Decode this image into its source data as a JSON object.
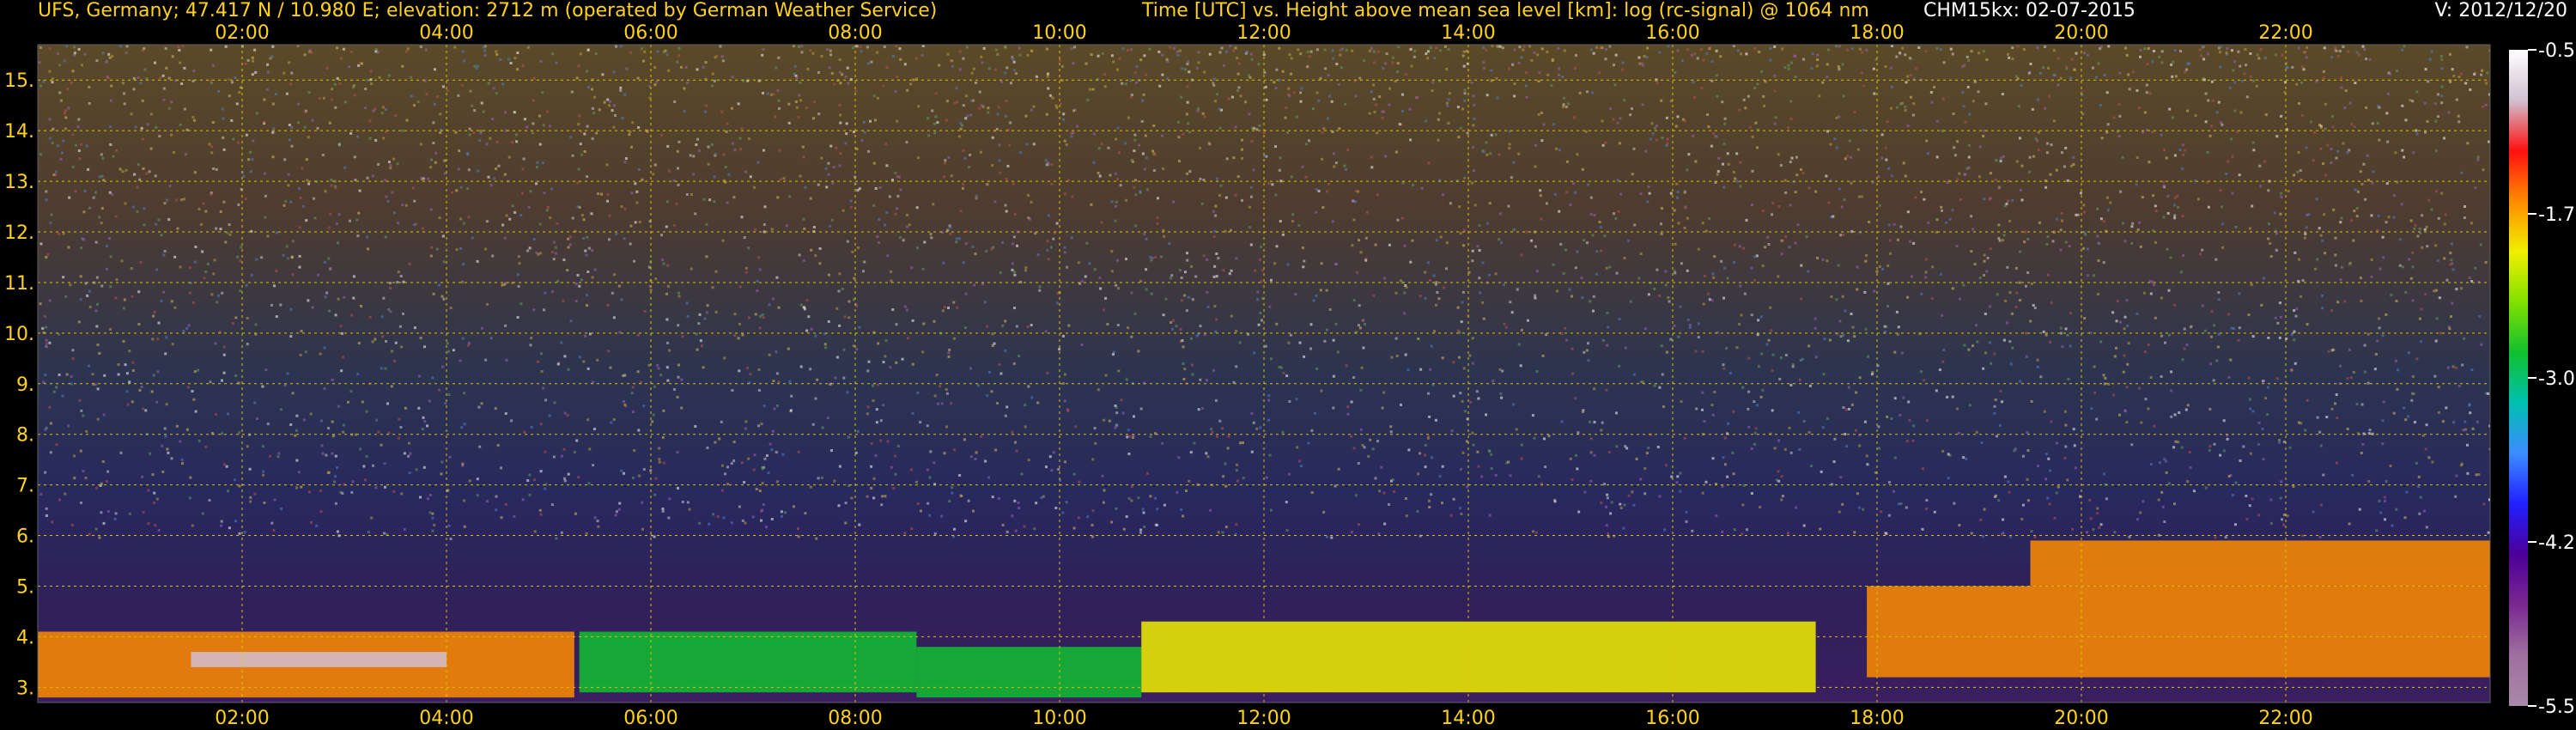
{
  "header": {
    "station": "UFS, Germany; 47.417 N / 10.980 E; elevation: 2712 m  (operated by German Weather Service)",
    "title": "Time [UTC] vs. Height above mean sea level [km]: log (rc-signal) @ 1064 nm",
    "instrument": "CHM15kx: 02-07-2015",
    "version": "V: 2012/12/20"
  },
  "colors": {
    "background": "#000000",
    "header_text": "#ffd21a",
    "tick_text": "#ffd21a",
    "instrument_text": "#ffffff",
    "grid": "#e0c400",
    "colorbar_text": "#ffffff"
  },
  "chart_data": {
    "type": "heatmap",
    "title": "Time [UTC] vs. Height above mean sea level [km]: log (rc-signal) @ 1064 nm",
    "xlabel": "Time [UTC]",
    "ylabel": "Height above mean sea level [km]",
    "x_unit": "hours UTC",
    "xlim": [
      0.0,
      24.0
    ],
    "ylim": [
      2.7,
      15.7
    ],
    "x_ticks": [
      2,
      4,
      6,
      8,
      10,
      12,
      14,
      16,
      18,
      20,
      22
    ],
    "x_tick_labels": [
      "02:00",
      "04:00",
      "06:00",
      "08:00",
      "10:00",
      "12:00",
      "14:00",
      "16:00",
      "18:00",
      "20:00",
      "22:00"
    ],
    "y_ticks": [
      3,
      4,
      5,
      6,
      7,
      8,
      9,
      10,
      11,
      12,
      13,
      14,
      15
    ],
    "y_tick_labels": [
      "3.",
      "4.",
      "5.",
      "6.",
      "7.",
      "8.",
      "9.",
      "10.",
      "11.",
      "12.",
      "13.",
      "14.",
      "15."
    ],
    "grid": true,
    "colorbar": {
      "range": [
        -5.5,
        -0.5
      ],
      "ticks": [
        -5.5,
        -4.25,
        -3.0,
        -1.75,
        -0.5
      ],
      "tick_labels": [
        "-5.50",
        "-4.25",
        "-3.00",
        "-1.75",
        "-0.50"
      ],
      "palette": [
        "#a888a8",
        "#a070a0",
        "#7a2890",
        "#4c0098",
        "#2020ff",
        "#3c8cff",
        "#00c0b0",
        "#10c030",
        "#80e000",
        "#f0f000",
        "#ff8c00",
        "#ff1010",
        "#d0c0d0",
        "#ffffff"
      ]
    },
    "features": [
      {
        "start_h": 0.0,
        "end_h": 5.25,
        "y_bottom_km": 2.8,
        "y_top_km": 4.1,
        "value": -1.6
      },
      {
        "start_h": 1.5,
        "end_h": 4.0,
        "y_bottom_km": 3.4,
        "y_top_km": 3.7,
        "value": -1.0
      },
      {
        "start_h": 5.3,
        "end_h": 8.6,
        "y_bottom_km": 2.9,
        "y_top_km": 4.1,
        "value": -2.7
      },
      {
        "start_h": 8.6,
        "end_h": 10.8,
        "y_bottom_km": 2.8,
        "y_top_km": 3.8,
        "value": -3.0
      },
      {
        "start_h": 10.8,
        "end_h": 17.4,
        "y_bottom_km": 2.9,
        "y_top_km": 4.3,
        "value": -2.0
      },
      {
        "start_h": 17.9,
        "end_h": 24.0,
        "y_bottom_km": 3.2,
        "y_top_km": 5.0,
        "value": -1.8
      },
      {
        "start_h": 19.5,
        "end_h": 24.0,
        "y_bottom_km": 5.0,
        "y_top_km": 5.9,
        "value": -1.5
      }
    ]
  }
}
